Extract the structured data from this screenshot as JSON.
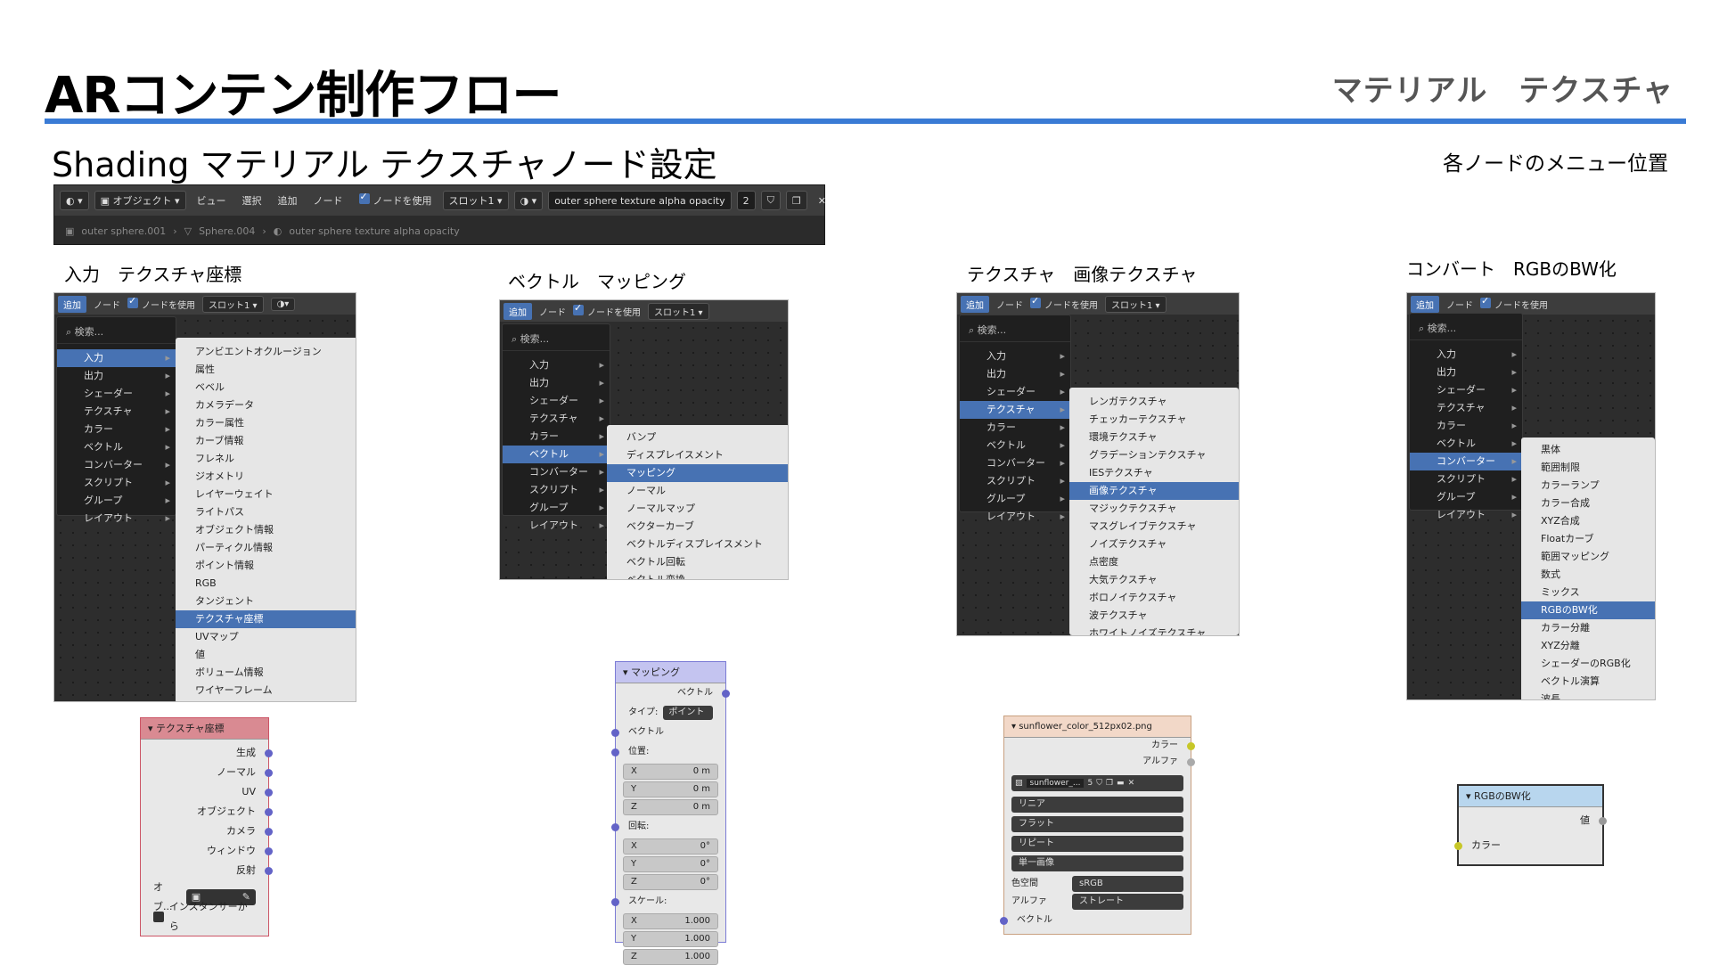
{
  "page": {
    "title": "ARコンテン制作フロー",
    "title_right": "マテリアル　テクスチャ",
    "subtitle": "Shading マテリアル テクスチャノード設定",
    "subtitle_right": "各ノードのメニュー位置",
    "accent_color": "#3a7bd5"
  },
  "header_bar": {
    "mode": "オブジェクト",
    "menu": [
      "ビュー",
      "選択",
      "追加",
      "ノード"
    ],
    "use_nodes": "ノードを使用",
    "slot": "スロット1",
    "material_name": "outer sphere texture alpha opacity",
    "user_count": "2",
    "breadcrumb": [
      "outer sphere.001",
      "Sphere.004",
      "outer sphere texture alpha opacity"
    ]
  },
  "common": {
    "add": "追加",
    "node": "ノード",
    "use_nodes": "ノードを使用",
    "slot": "スロット1",
    "search": "検索...",
    "categories": [
      "入力",
      "出力",
      "シェーダー",
      "テクスチャ",
      "カラー",
      "ベクトル",
      "コンバーター",
      "スクリプト",
      "グループ",
      "レイアウト"
    ]
  },
  "sections": [
    {
      "label": "入力　テクスチャ座標",
      "selected_category": "入力",
      "submenu": [
        "アンビエントオクルージョン",
        "属性",
        "ベベル",
        "カメラデータ",
        "カラー属性",
        "カーブ情報",
        "フレネル",
        "ジオメトリ",
        "レイヤーウェイト",
        "ライトパス",
        "オブジェクト情報",
        "パーティクル情報",
        "ポイント情報",
        "RGB",
        "タンジェント",
        "テクスチャ座標",
        "UVマップ",
        "値",
        "ボリューム情報",
        "ワイヤーフレーム"
      ],
      "selected_item": "テクスチャ座標",
      "node": {
        "title": "テクスチャ座標",
        "outputs": [
          "生成",
          "ノーマル",
          "UV",
          "オブジェクト",
          "カメラ",
          "ウィンドウ",
          "反射"
        ],
        "object_label": "オブ...",
        "instancer": "インスタンサーから"
      }
    },
    {
      "label": "ベクトル　マッピング",
      "selected_category": "ベクトル",
      "submenu": [
        "バンプ",
        "ディスプレイスメント",
        "マッピング",
        "ノーマル",
        "ノーマルマップ",
        "ベクターカーブ",
        "ベクトルディスプレイスメント",
        "ベクトル回転",
        "ベクトル変換"
      ],
      "selected_item": "マッピング",
      "node": {
        "title": "マッピング",
        "output": "ベクトル",
        "type_label": "タイプ:",
        "type_value": "ポイント",
        "vector_in": "ベクトル",
        "location_label": "位置:",
        "location": [
          [
            "X",
            "0 m"
          ],
          [
            "Y",
            "0 m"
          ],
          [
            "Z",
            "0 m"
          ]
        ],
        "rotation_label": "回転:",
        "rotation": [
          [
            "X",
            "0°"
          ],
          [
            "Y",
            "0°"
          ],
          [
            "Z",
            "0°"
          ]
        ],
        "scale_label": "スケール:",
        "scale": [
          [
            "X",
            "1.000"
          ],
          [
            "Y",
            "1.000"
          ],
          [
            "Z",
            "1.000"
          ]
        ]
      }
    },
    {
      "label": "テクスチャ　画像テクスチャ",
      "selected_category": "テクスチャ",
      "submenu": [
        "レンガテクスチャ",
        "チェッカーテクスチャ",
        "環境テクスチャ",
        "グラデーションテクスチャ",
        "IESテクスチャ",
        "画像テクスチャ",
        "マジックテクスチャ",
        "マスグレイブテクスチャ",
        "ノイズテクスチャ",
        "点密度",
        "大気テクスチャ",
        "ボロノイテクスチャ",
        "波テクスチャ",
        "ホワイトノイズテクスチャ"
      ],
      "selected_item": "画像テクスチャ",
      "node": {
        "title": "sunflower_color_512px02.png",
        "outputs": [
          "カラー",
          "アルファ"
        ],
        "image_name": "sunflower_...",
        "image_users": "5",
        "dropdowns": [
          "リニア",
          "フラット",
          "リピート",
          "単一画像"
        ],
        "colorspace_label": "色空間",
        "colorspace": "sRGB",
        "alpha_label": "アルファ",
        "alpha": "ストレート",
        "vector_in": "ベクトル"
      }
    },
    {
      "label": "コンバート　RGBのBW化",
      "selected_category": "コンバーター",
      "submenu": [
        "黒体",
        "範囲制限",
        "カラーランプ",
        "カラー合成",
        "XYZ合成",
        "Floatカーブ",
        "範囲マッピング",
        "数式",
        "ミックス",
        "RGBのBW化",
        "カラー分離",
        "XYZ分離",
        "シェーダーのRGB化",
        "ベクトル演算",
        "波長"
      ],
      "selected_item": "RGBのBW化",
      "node": {
        "title": "RGBのBW化",
        "output": "値",
        "input": "カラー"
      }
    }
  ]
}
